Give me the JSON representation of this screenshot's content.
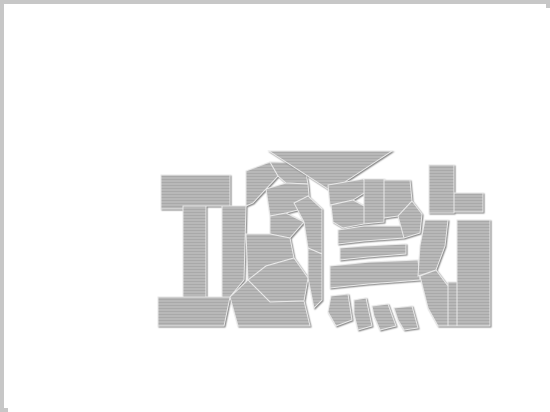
{
  "canvas": {
    "background": "#ffffff",
    "border_color": "#c7c7c7"
  },
  "logo": {
    "text": "正點",
    "glyph_1": "正",
    "glyph_2": "點",
    "style": "shattered-embossed",
    "fill_color": "#b4b4b4",
    "stripe_color": "#a6a6a6",
    "edge_light": "#e6e6e6",
    "edge_dark": "#8a8a8a",
    "shadow_color": "#8c8c8c"
  }
}
